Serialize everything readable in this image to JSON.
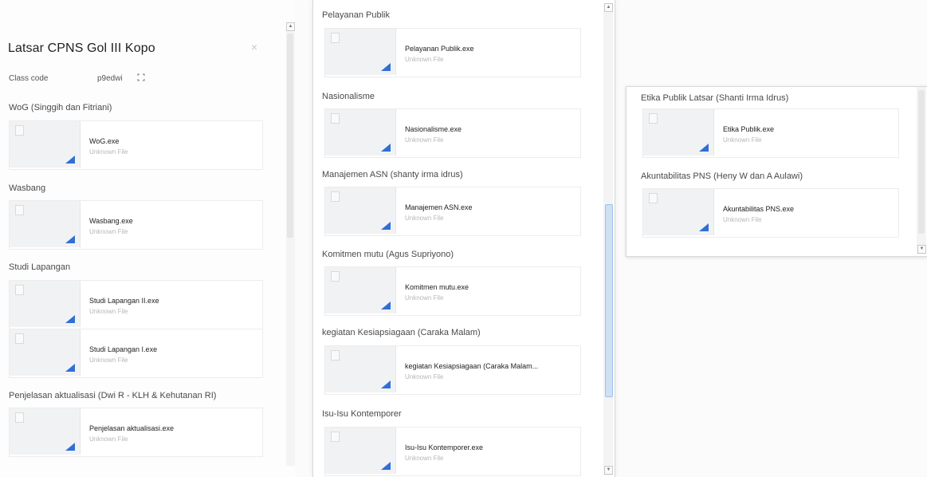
{
  "left_panel": {
    "title": "Latsar CPNS Gol III Kopo",
    "class_code_label": "Class code",
    "class_code_value": "p9edwi",
    "sections": [
      {
        "title": "WoG (Singgih dan Fitriani)",
        "files": [
          {
            "name": "WoG.exe",
            "type": "Unknown File"
          }
        ]
      },
      {
        "title": "Wasbang",
        "files": [
          {
            "name": "Wasbang.exe",
            "type": "Unknown File"
          }
        ]
      },
      {
        "title": "Studi Lapangan",
        "files": [
          {
            "name": "Studi Lapangan II.exe",
            "type": "Unknown File"
          },
          {
            "name": "Studi Lapangan I.exe",
            "type": "Unknown File"
          }
        ]
      },
      {
        "title": "Penjelasan aktualisasi (Dwi R - KLH & Kehutanan RI)",
        "files": [
          {
            "name": "Penjelasan aktualisasi.exe",
            "type": "Unknown File"
          }
        ]
      }
    ]
  },
  "middle_panel": {
    "sections": [
      {
        "title": "Pelayanan Publik",
        "files": [
          {
            "name": "Pelayanan Publik.exe",
            "type": "Unknown File"
          }
        ]
      },
      {
        "title": "Nasionalisme",
        "files": [
          {
            "name": "Nasionalisme.exe",
            "type": "Unknown File"
          }
        ]
      },
      {
        "title": "Manajemen ASN (shanty irma idrus)",
        "files": [
          {
            "name": "Manajemen ASN.exe",
            "type": "Unknown File"
          }
        ]
      },
      {
        "title": "Komitmen mutu (Agus Supriyono)",
        "files": [
          {
            "name": "Komitmen mutu.exe",
            "type": "Unknown File"
          }
        ]
      },
      {
        "title": "kegiatan Kesiapsiagaan (Caraka Malam)",
        "files": [
          {
            "name": "kegiatan Kesiapsiagaan (Caraka Malam...",
            "type": "Unknown File"
          }
        ]
      },
      {
        "title": "Isu-Isu Kontemporer",
        "files": [
          {
            "name": "Isu-Isu Kontemporer.exe",
            "type": "Unknown File"
          }
        ]
      }
    ]
  },
  "right_panel": {
    "sections": [
      {
        "title": "Etika Publik Latsar (Shanti Irma Idrus)",
        "files": [
          {
            "name": "Etika Publik.exe",
            "type": "Unknown File"
          }
        ]
      },
      {
        "title": "Akuntabilitas PNS (Heny W dan A Aulawi)",
        "files": [
          {
            "name": "Akuntabilitas PNS.exe",
            "type": "Unknown File"
          }
        ]
      }
    ]
  },
  "icons": {
    "close": "×",
    "scroll_up": "▲",
    "scroll_down": "▼"
  },
  "colors": {
    "scroll_thumb_active": "#cfe0f5",
    "scroll_thumb_inactive": "#e6e6e6",
    "file_corner_icon": "#2f6fd6"
  }
}
